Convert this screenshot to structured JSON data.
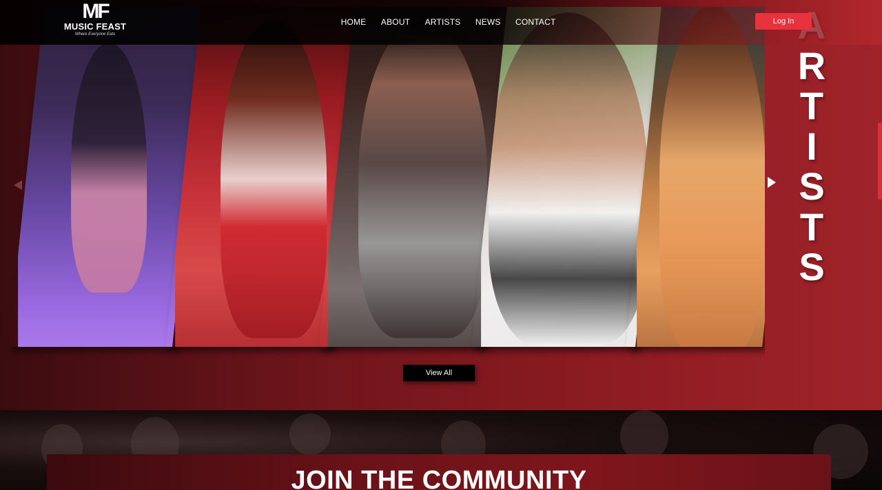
{
  "brand": {
    "mark": "MF",
    "name": "MUSIC FEAST",
    "tagline": "Where Everyone Eats"
  },
  "nav": {
    "links": [
      "HOME",
      "ABOUT",
      "ARTISTS",
      "NEWS",
      "CONTACT"
    ],
    "login_label": "Log In"
  },
  "artists_section": {
    "vertical_letters": [
      "A",
      "R",
      "T",
      "I",
      "S",
      "T",
      "S"
    ],
    "view_all_label": "View All",
    "cards": [
      {
        "name": "artist-photo-1"
      },
      {
        "name": "artist-photo-2"
      },
      {
        "name": "artist-photo-3"
      },
      {
        "name": "artist-photo-4"
      },
      {
        "name": "artist-photo-5"
      }
    ],
    "prev_icon": "chevron-left-icon",
    "next_icon": "chevron-right-icon"
  },
  "community": {
    "title": "JOIN THE COMMUNITY"
  },
  "colors": {
    "accent": "#e8333f",
    "section_bg": "#8e1c22",
    "nav_bg": "#000000"
  }
}
